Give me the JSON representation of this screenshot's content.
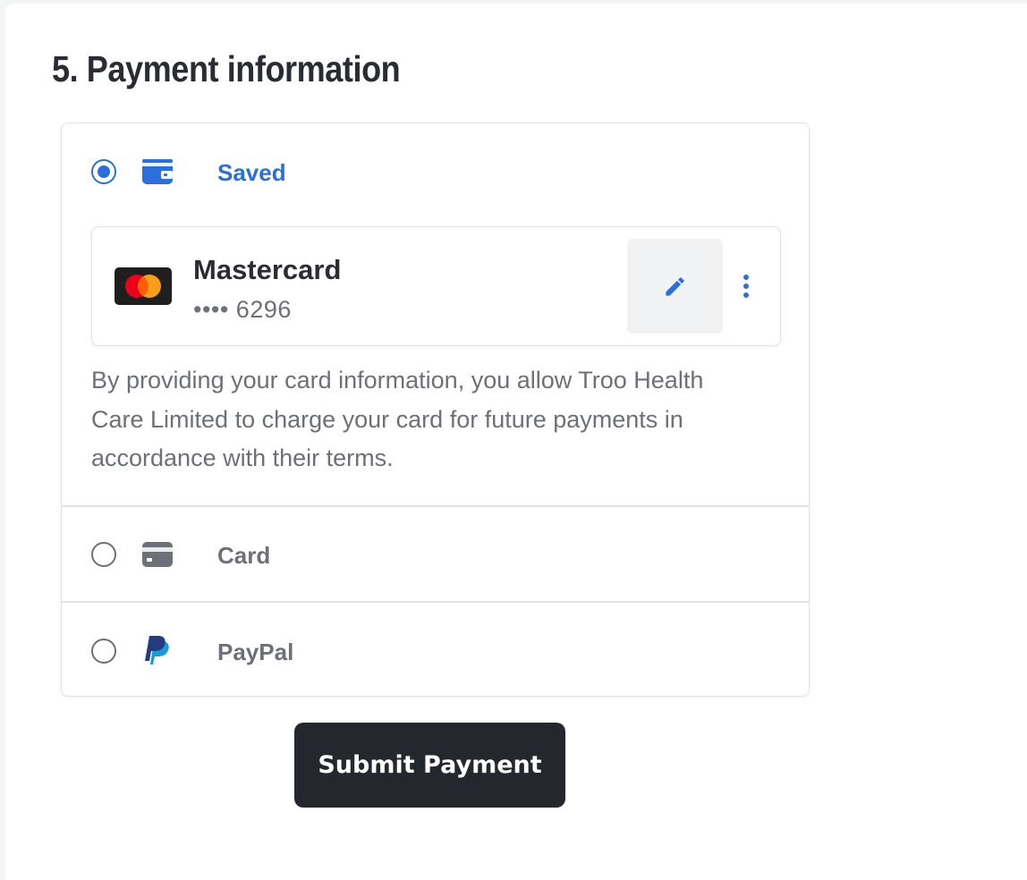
{
  "section": {
    "title": "5. Payment information"
  },
  "payment_methods": [
    {
      "id": "saved",
      "label": "Saved",
      "selected": true,
      "icon": "wallet-icon"
    },
    {
      "id": "card",
      "label": "Card",
      "selected": false,
      "icon": "credit-card-icon"
    },
    {
      "id": "paypal",
      "label": "PayPal",
      "selected": false,
      "icon": "paypal-icon"
    }
  ],
  "saved_card": {
    "brand": "Mastercard",
    "masked_number": "•••• 6296",
    "logo_icon": "mastercard-icon",
    "edit_icon": "pencil-icon",
    "more_icon": "more-vertical-icon"
  },
  "consent_text": "By providing your card information, you allow Troo Health Care Limited to charge your card for future payments in accordance with their terms.",
  "submit": {
    "label": "Submit Payment"
  },
  "colors": {
    "accent": "#2a6fdb",
    "muted_text": "#6d7078",
    "border": "#e0e2e6",
    "button_bg": "#24272e",
    "mastercard_red": "#eb001b",
    "mastercard_orange": "#f79e1b"
  }
}
